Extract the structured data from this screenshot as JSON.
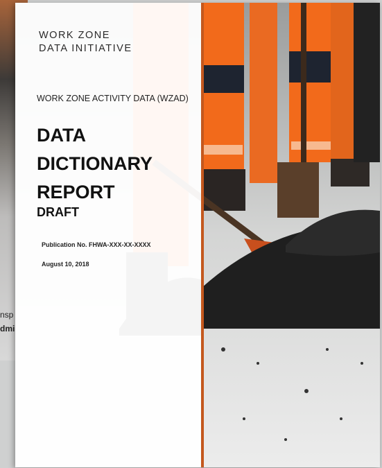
{
  "background_document": {
    "fragment_1": "nsp",
    "fragment_2": "dmi"
  },
  "cover": {
    "organization_line_1": "WORK ZONE",
    "organization_line_2": "DATA INITIATIVE",
    "series_title": "WORK ZONE ACTIVITY DATA (WZAD)",
    "title_line_1": "DATA",
    "title_line_2": "DICTIONARY",
    "title_line_3": "REPORT",
    "status": "DRAFT",
    "publication_number": "Publication No. FHWA-XXX-XX-XXXX",
    "date": "August 10, 2018"
  },
  "colors": {
    "accent_divider": "#c4581e",
    "safety_orange": "#f26a1b",
    "asphalt": "#1f1f1f"
  },
  "image": {
    "subject": "road workers in orange high-visibility gear shoveling asphalt"
  }
}
